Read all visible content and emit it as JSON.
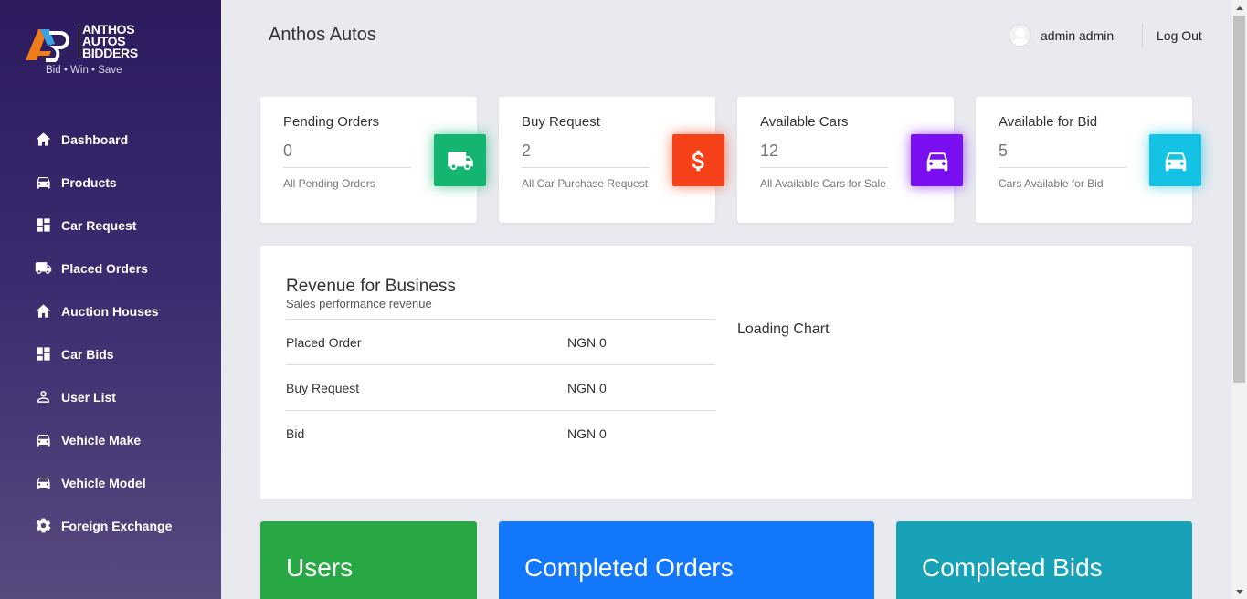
{
  "app": {
    "logo_words": [
      "ANTHOS",
      "AUTOS",
      "BIDDERS"
    ],
    "logo_tagline": "Bid • Win • Save",
    "title": "Anthos Autos"
  },
  "sidebar": {
    "items": [
      {
        "label": "Dashboard",
        "icon": "home-icon"
      },
      {
        "label": "Products",
        "icon": "car-icon"
      },
      {
        "label": "Car Request",
        "icon": "dashboard-grid-icon"
      },
      {
        "label": "Placed Orders",
        "icon": "truck-icon"
      },
      {
        "label": "Auction Houses",
        "icon": "home-icon"
      },
      {
        "label": "Car Bids",
        "icon": "dashboard-grid-icon"
      },
      {
        "label": "User List",
        "icon": "user-icon"
      },
      {
        "label": "Vehicle Make",
        "icon": "car-icon"
      },
      {
        "label": "Vehicle Model",
        "icon": "car-icon"
      },
      {
        "label": "Foreign Exchange",
        "icon": "gear-icon"
      }
    ]
  },
  "header": {
    "user_name": "admin admin",
    "logout_label": "Log Out"
  },
  "stats": [
    {
      "title": "Pending Orders",
      "value": "0",
      "sub": "All Pending Orders",
      "icon": "truck-icon",
      "color": "#14b571"
    },
    {
      "title": "Buy Request",
      "value": "2",
      "sub": "All Car Purchase Request",
      "icon": "dollar-icon",
      "color": "#f5421a"
    },
    {
      "title": "Available Cars",
      "value": "12",
      "sub": "All Available Cars for Sale",
      "icon": "car-icon",
      "color": "#7a10f2"
    },
    {
      "title": "Available for Bid",
      "value": "5",
      "sub": "Cars Available for Bid",
      "icon": "car-icon",
      "color": "#14c3e4"
    }
  ],
  "revenue": {
    "title": "Revenue for Business",
    "subtitle": "Sales performance revenue",
    "rows": [
      {
        "label": "Placed Order",
        "value": "NGN 0"
      },
      {
        "label": "Buy Request",
        "value": "NGN 0"
      },
      {
        "label": "Bid",
        "value": "NGN 0"
      }
    ],
    "chart_status": "Loading Chart"
  },
  "summary_cards": [
    {
      "label": "Users",
      "color": "#28a745"
    },
    {
      "label": "Completed Orders",
      "color": "#1277fb"
    },
    {
      "label": "Completed Bids",
      "color": "#17a2b8"
    }
  ]
}
